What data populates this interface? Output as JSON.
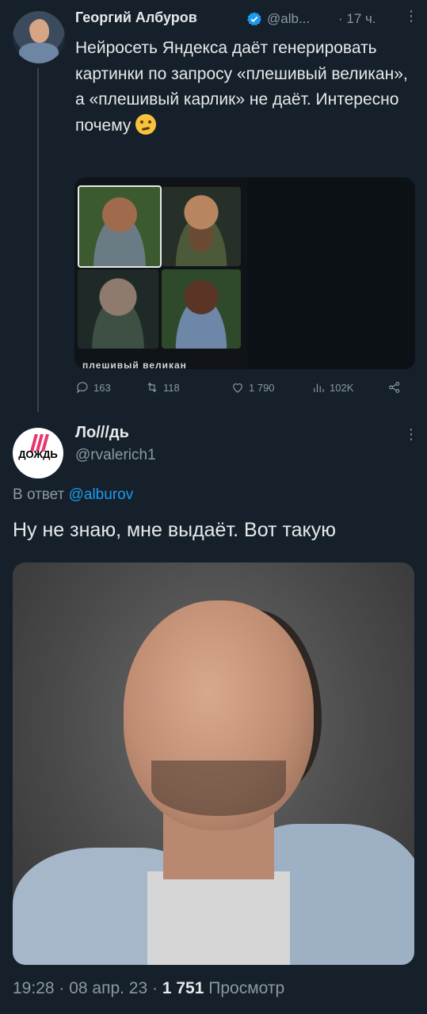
{
  "tweet1": {
    "author_name": "Георгий Албуров",
    "handle": "@alb...",
    "time": "· 17 ч.",
    "more": "⋮",
    "text": "Нейросеть Яндекса даёт генерировать картинки по запросу «плешивый великан», а «плешивый карлик» не даёт. Интересно почему",
    "media_caption": "плешивый великан",
    "actions": {
      "replies": "163",
      "retweets": "118",
      "likes": "1 790",
      "views": "102K"
    },
    "colors": {
      "verified": "#1d9bf0"
    }
  },
  "tweet2": {
    "author_name": "Ло///дь",
    "handle": "@rvalerich1",
    "more": "⋮",
    "avatar_logo_text": "ДОЖДЬ",
    "reply_prefix": "В ответ",
    "reply_to": "@alburov",
    "text": "Ну не знаю, мне выдаёт. Вот такую",
    "meta_time": "19:28 · 08 апр. 23 ·",
    "meta_views": "1 751",
    "meta_views_label": "Просмотр"
  },
  "icons": [
    "reply-icon",
    "retweet-icon",
    "like-icon",
    "views-icon",
    "share-icon",
    "verified-icon",
    "thinking-emoji-icon"
  ],
  "theme": {
    "background": "#15202b",
    "muted": "#8b98a5",
    "link": "#1d9bf0"
  }
}
